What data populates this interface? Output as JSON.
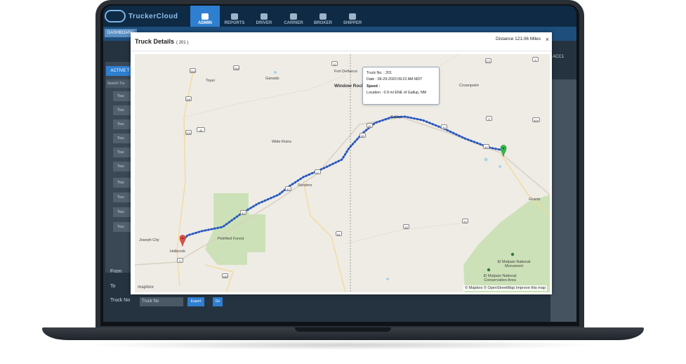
{
  "app": {
    "logo_text": "TruckerCloud",
    "nav_tabs": [
      {
        "label": "ADMIN",
        "active": true
      },
      {
        "label": "REPORTS",
        "active": false
      },
      {
        "label": "DRIVER",
        "active": false
      },
      {
        "label": "CARRIER",
        "active": false
      },
      {
        "label": "BROKER",
        "active": false
      },
      {
        "label": "SHIPPER",
        "active": false
      }
    ],
    "subnav_first": "DASHBOARD",
    "active_button": "ACTIVE T",
    "search_placeholder": "Search Tru",
    "side_items": [
      "Truc",
      "Truc",
      "Truc",
      "Truc",
      "Truc",
      "Truc",
      "Truc",
      "Truc",
      "Truc",
      "Truc"
    ],
    "from_label": "From",
    "to_label": "To",
    "truck_no_label": "Truck No",
    "truck_select_value": "Truck No",
    "export_label": "Export",
    "go_label": "Go",
    "bg_right_label": "ACC1"
  },
  "modal": {
    "title": "Truck Details",
    "truck_number": "( 201 )",
    "distance": "Distance 121.06 Miles",
    "close": "×"
  },
  "popup": {
    "truck_no": "Truck No. : 201",
    "date": "Date : 09-29-2020 09:22 AM MDT",
    "speed": "Speed :",
    "location": "Location : 0.9 mi ENE of Gallup, NM"
  },
  "map": {
    "places": [
      "Toyei",
      "Ganado",
      "Fort Defiance",
      "Window Rock",
      "Crownpoint",
      "Wide Ruins",
      "Gallup",
      "Sanders",
      "Joseph City",
      "Holbrook",
      "Petrified Forest",
      "Grants",
      "El Malpais National Monument",
      "El Malpais National Conservation Area"
    ],
    "route_shields": [
      "264",
      "264",
      "12",
      "191",
      "40",
      "371",
      "9",
      "491",
      "191",
      "40",
      "40",
      "40",
      "40",
      "40",
      "40",
      "77",
      "180",
      "61",
      "53",
      "53",
      "509",
      "9",
      "17"
    ],
    "mapbox_logo": "mapbox",
    "attribution": "© Mapbox © OpenStreetMap Improve this map",
    "route_color": "#3b6fd8",
    "start_marker_color": "#e0524a",
    "end_marker_color": "#2fbf4a"
  }
}
